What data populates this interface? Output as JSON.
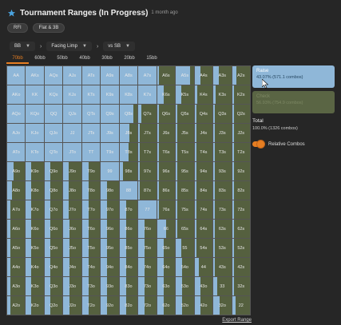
{
  "header": {
    "title": "Tournament Ranges (In Progress)",
    "subtitle": "1 month ago",
    "star_color": "#4aa3df"
  },
  "tags": [
    "RFI",
    "Flat & 3B"
  ],
  "selectors": {
    "position": "BB",
    "action": "Facing Limp",
    "vs": "vs SB"
  },
  "stacks": {
    "tabs": [
      "70bb",
      "60bb",
      "50bb",
      "40bb",
      "30bb",
      "20bb",
      "15bb"
    ],
    "active_index": 0
  },
  "grid": {
    "rows": [
      [
        "AA",
        "AKs",
        "AQs",
        "AJs",
        "ATs",
        "A9s",
        "A8s",
        "A7s",
        "A6s",
        "A5s",
        "A4s",
        "A3s",
        "A2s"
      ],
      [
        "AKo",
        "KK",
        "KQs",
        "KJs",
        "KTs",
        "K9s",
        "K8s",
        "K7s",
        "K6s",
        "K5s",
        "K4s",
        "K3s",
        "K2s"
      ],
      [
        "AQo",
        "KQo",
        "QQ",
        "QJs",
        "QTs",
        "Q9s",
        "Q8s",
        "Q7s",
        "Q6s",
        "Q5s",
        "Q4s",
        "Q3s",
        "Q2s"
      ],
      [
        "AJo",
        "KJo",
        "QJo",
        "JJ",
        "JTs",
        "J9s",
        "J8s",
        "J7s",
        "J6s",
        "J5s",
        "J4s",
        "J3s",
        "J2s"
      ],
      [
        "ATo",
        "KTo",
        "QTo",
        "JTo",
        "TT",
        "T9s",
        "T8s",
        "T7s",
        "T6s",
        "T5s",
        "T4s",
        "T3s",
        "T2s"
      ],
      [
        "A9o",
        "K9o",
        "Q9o",
        "J9o",
        "T9o",
        "99",
        "98s",
        "97s",
        "96s",
        "95s",
        "94s",
        "93s",
        "92s"
      ],
      [
        "A8o",
        "K8o",
        "Q8o",
        "J8o",
        "T8o",
        "98o",
        "88",
        "87s",
        "86s",
        "85s",
        "84s",
        "83s",
        "82s"
      ],
      [
        "A7o",
        "K7o",
        "Q7o",
        "J7o",
        "T7o",
        "97o",
        "87o",
        "77",
        "76s",
        "75s",
        "74s",
        "73s",
        "72s"
      ],
      [
        "A6o",
        "K6o",
        "Q6o",
        "J6o",
        "T6o",
        "96o",
        "86o",
        "76o",
        "66",
        "65s",
        "64s",
        "63s",
        "62s"
      ],
      [
        "A5o",
        "K5o",
        "Q5o",
        "J5o",
        "T5o",
        "95o",
        "85o",
        "75o",
        "65o",
        "55",
        "54s",
        "53s",
        "52s"
      ],
      [
        "A4o",
        "K4o",
        "Q4o",
        "J4o",
        "T4o",
        "94o",
        "84o",
        "74o",
        "64o",
        "54o",
        "44",
        "43s",
        "42s"
      ],
      [
        "A3o",
        "K3o",
        "Q3o",
        "J3o",
        "T3o",
        "93o",
        "83o",
        "73o",
        "63o",
        "53o",
        "43o",
        "33",
        "32s"
      ],
      [
        "A2o",
        "K2o",
        "Q2o",
        "J2o",
        "T2o",
        "92o",
        "82o",
        "72o",
        "62o",
        "52o",
        "42o",
        "32o",
        "22"
      ]
    ],
    "raise_freq": [
      [
        1,
        1,
        1,
        1,
        1,
        1,
        1,
        1,
        0.1,
        0.8,
        0.35,
        0.3,
        0.25
      ],
      [
        1,
        1,
        1,
        1,
        1,
        1,
        1,
        1,
        0.35,
        0.3,
        0.15,
        0.15,
        0.1
      ],
      [
        1,
        1,
        1,
        1,
        1,
        1,
        0.75,
        0.15,
        0.1,
        0.1,
        0.1,
        0.1,
        0.1
      ],
      [
        1,
        1,
        1,
        1,
        1,
        1,
        0.55,
        0.1,
        0.1,
        0.1,
        0.1,
        0.1,
        0.1
      ],
      [
        1,
        1,
        1,
        1,
        1,
        1,
        0.5,
        0.1,
        0.1,
        0.1,
        0.1,
        0.1,
        0.1
      ],
      [
        0.35,
        0.3,
        0.3,
        0.3,
        0.35,
        1,
        0.2,
        0.1,
        0.1,
        0.1,
        0.1,
        0.1,
        0.1
      ],
      [
        0.25,
        0.3,
        0.3,
        0.3,
        0.35,
        0.35,
        1,
        0.1,
        0.1,
        0.1,
        0.1,
        0.1,
        0.1
      ],
      [
        0.2,
        0.3,
        0.3,
        0.3,
        0.35,
        0.35,
        0.35,
        1,
        0.1,
        0.1,
        0.1,
        0.1,
        0.1
      ],
      [
        0.2,
        0.3,
        0.3,
        0.35,
        0.35,
        0.35,
        0.35,
        0.35,
        0.5,
        0.1,
        0.1,
        0.1,
        0.1
      ],
      [
        0.2,
        0.3,
        0.3,
        0.35,
        0.35,
        0.35,
        0.35,
        0.35,
        0.35,
        0.3,
        0.1,
        0.1,
        0.1
      ],
      [
        0.2,
        0.3,
        0.3,
        0.35,
        0.35,
        0.35,
        0.35,
        0.35,
        0.35,
        0.35,
        0.25,
        0.1,
        0.1
      ],
      [
        0.2,
        0.3,
        0.3,
        0.35,
        0.35,
        0.35,
        0.35,
        0.35,
        0.35,
        0.35,
        0.35,
        0.2,
        0.1
      ],
      [
        0.2,
        0.3,
        0.3,
        0.35,
        0.35,
        0.35,
        0.35,
        0.35,
        0.35,
        0.35,
        0.35,
        0.35,
        0.2
      ]
    ],
    "raise_color": "#8fb7d8",
    "fold_color": "#55603f"
  },
  "actions": {
    "raise": {
      "name": "Raise",
      "value": "43.07% (571.1 combos)"
    },
    "fold": {
      "name": "Check",
      "value": "56.93% (754.9 combos)"
    }
  },
  "total": {
    "label": "Total",
    "value": "100.0% (1326 combos)"
  },
  "toggle": {
    "label": "Relative Combos",
    "on": true
  },
  "footer": {
    "export": "Export Range"
  }
}
